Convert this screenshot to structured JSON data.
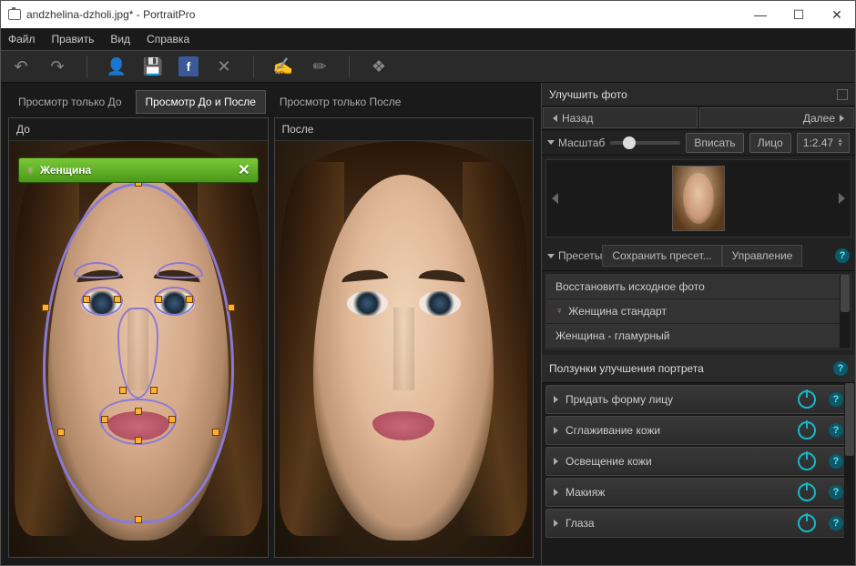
{
  "window": {
    "title": "andzhelina-dzholi.jpg* - PortraitPro"
  },
  "menu": {
    "file": "Файл",
    "edit": "Править",
    "view": "Вид",
    "help": "Справка"
  },
  "view_tabs": {
    "before_only": "Просмотр только До",
    "before_after": "Просмотр До и После",
    "after_only": "Просмотр только После"
  },
  "panels": {
    "before": "До",
    "after": "После"
  },
  "gender_tag": {
    "label": "Женщина",
    "close": "✕",
    "symbol": "♀"
  },
  "right": {
    "header": "Улучшить фото",
    "back": "Назад",
    "next": "Далее",
    "zoom_label": "Масштаб",
    "fit": "Вписать",
    "face": "Лицо",
    "ratio": "1:2.47",
    "presets_tab": "Пресеты",
    "save_preset": "Сохранить пресет...",
    "manage": "Управление",
    "presets": [
      "Восстановить исходное фото",
      "Женщина стандарт",
      "Женщина - гламурный"
    ],
    "sliders_header": "Ползунки улучшения портрета",
    "controls": [
      "Придать форму лицу",
      "Сглаживание кожи",
      "Освещение кожи",
      "Макияж",
      "Глаза"
    ]
  }
}
